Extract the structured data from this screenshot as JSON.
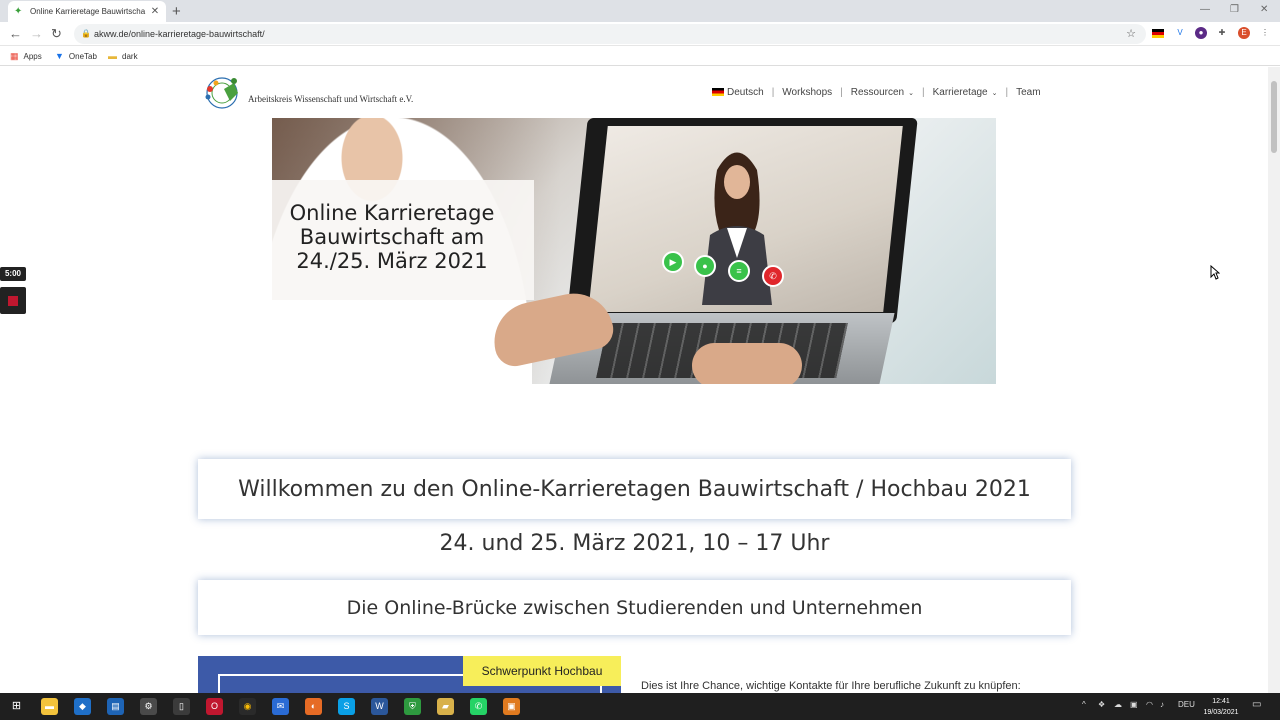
{
  "browser": {
    "tab_title": "Online Karrieretage Bauwirtscha",
    "new_tab_symbol": "+",
    "url": "akww.de/online-karrieretage-bauwirtschaft/",
    "bookmarks": [
      {
        "label": "Apps",
        "icon": "apps-grid-icon"
      },
      {
        "label": "OneTab",
        "icon": "onetab-icon"
      },
      {
        "label": "dark",
        "icon": "folder-icon"
      }
    ],
    "profile_initial": "E"
  },
  "site": {
    "logo_text": "Arbeitskreis Wissenschaft und Wirtschaft e.V.",
    "nav": {
      "language": "Deutsch",
      "workshops": "Workshops",
      "ressourcen": "Ressourcen",
      "karrieretage": "Karrieretage",
      "team": "Team"
    },
    "hero": {
      "line1": "Online Karrieretage",
      "line2": "Bauwirtschaft am",
      "line3": "24./25. März 2021"
    },
    "welcome": "Willkommen zu den Online-Karrieretagen Bauwirtschaft / Hochbau 2021",
    "date_line": "24. und 25. März 2021, 10 – 17 Uhr",
    "bridge": "Die Online-Brücke zwischen Studierenden und Unternehmen",
    "promo_badge": "Schwerpunkt Hochbau",
    "intro": "Dies ist Ihre Chance, wichtige Kontakte für Ihre berufliche Zukunft zu knüpfen:"
  },
  "recorder": {
    "timer": "5:00"
  },
  "taskbar": {
    "language": "DEU",
    "time": "12:41",
    "date": "19/03/2021"
  },
  "colors": {
    "primary_blue": "#3d5aa8",
    "badge_yellow": "#f7ee5a",
    "box_shadow": "#4a6eaa"
  }
}
